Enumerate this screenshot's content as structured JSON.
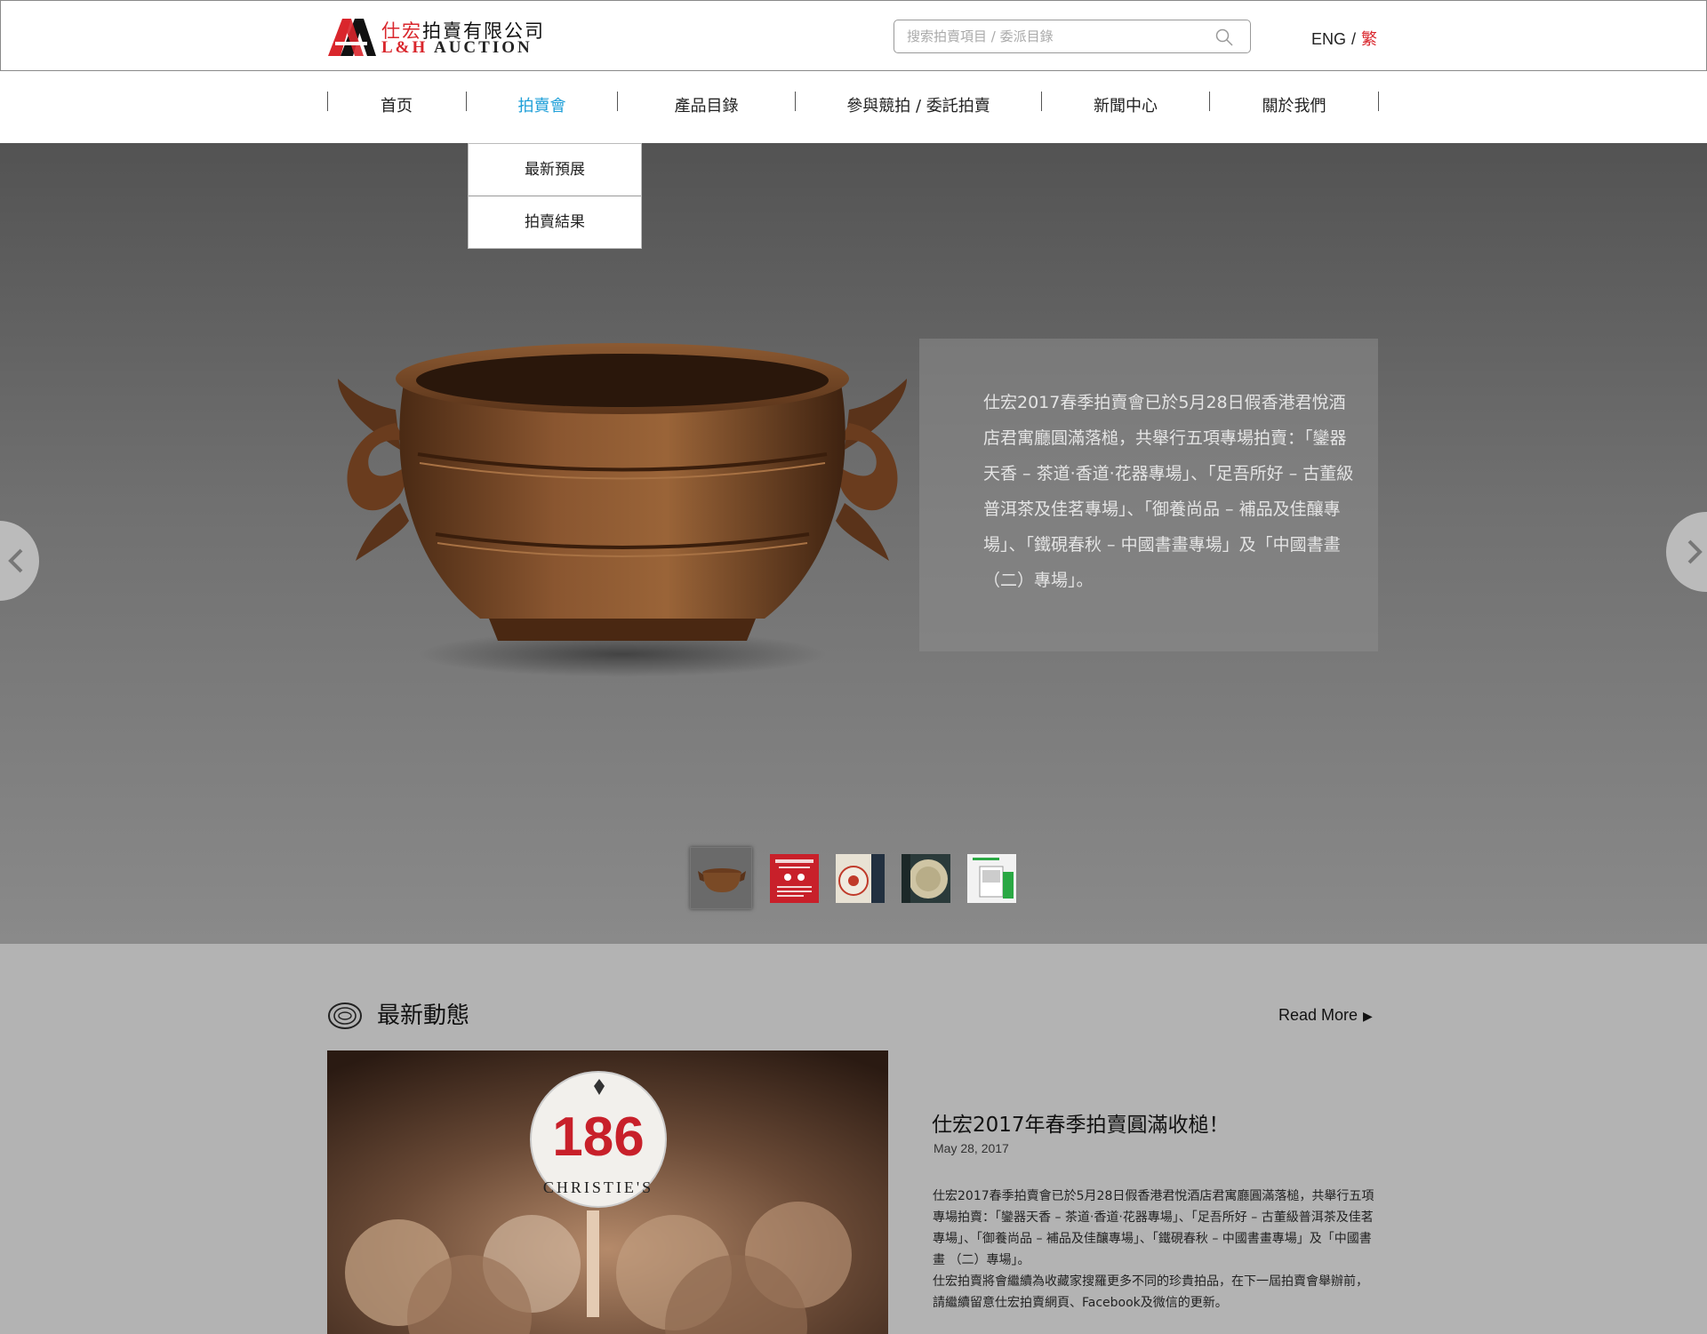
{
  "header": {
    "logo": {
      "cn_prefix": "仕宏",
      "cn_suffix": "拍賣有限公司",
      "en_prefix": "L&H",
      "en_suffix": "AUCTION"
    },
    "search": {
      "placeholder": "搜索拍賣項目 / 委派目錄",
      "icon": "search-icon"
    },
    "lang": {
      "eng": "ENG",
      "separator": "/",
      "trad": "繁"
    }
  },
  "nav": {
    "items": [
      {
        "label": "首页"
      },
      {
        "label": "拍賣會"
      },
      {
        "label": "產品目錄"
      },
      {
        "label": "參與競拍 / 委託拍賣"
      },
      {
        "label": "新聞中心"
      },
      {
        "label": "關於我們"
      }
    ],
    "active_index": 1,
    "dropdown": [
      {
        "label": "最新預展"
      },
      {
        "label": "拍賣結果"
      }
    ]
  },
  "hero": {
    "caption": "仕宏2017春季拍賣會已於5月28日假香港君悅酒店君寓廳圓滿落槌，共舉行五項專場拍賣：「鑾器天香 – 茶道‧香道‧花器專場」、「足吾所好 – 古董級普洱茶及佳茗專場」、「御養尚品 – 補品及佳釀專場」、「鐵硯春秋 – 中國書畫專場」及「中國書畫 （二）專場」。",
    "prev_icon": "chevron-left-icon",
    "next_icon": "chevron-right-icon",
    "thumbnail_count": 5,
    "active_thumbnail": 0
  },
  "news": {
    "heading": "最新動態",
    "read_more": "Read More",
    "read_more_icon": "triangle-right-icon",
    "article": {
      "title": "仕宏2017年春季拍賣圓滿收槌！",
      "date": "May 28, 2017",
      "paragraph1": "仕宏2017春季拍賣會已於5月28日假香港君悅酒店君寓廳圓滿落槌，共舉行五項專場拍賣：「鑾器天香 – 茶道‧香道‧花器專場」、「足吾所好 – 古董級普洱茶及佳茗專場」、「御養尚品 – 補品及佳釀專場」、「鐵硯春秋 – 中國書畫專場」及「中國書畫 （二）專場」。",
      "paragraph2": "仕宏拍賣將會繼續為收藏家搜羅更多不同的珍貴拍品，在下一屆拍賣會舉辦前，請繼續留意仕宏拍賣網頁、Facebook及微信的更新。",
      "paddle_number": "186",
      "paddle_text": "CHRISTIE'S"
    }
  },
  "colors": {
    "brand_red": "#d9262c",
    "nav_active": "#1e9fd8"
  }
}
